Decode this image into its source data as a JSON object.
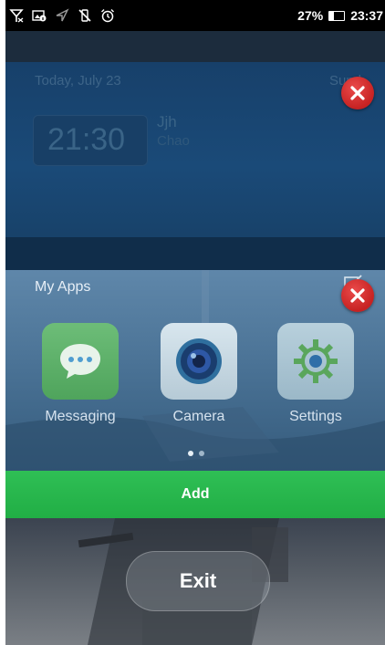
{
  "status_bar": {
    "battery_percent": "27%",
    "time": "23:37",
    "icons": [
      "signal-off-icon",
      "image-info-icon",
      "location-icon",
      "vibrate-off-icon",
      "alarm-icon",
      "battery-icon"
    ]
  },
  "recent_cards": [
    {
      "widget": {
        "date": "Today, July 23",
        "day": "Sund",
        "clock": "21:30",
        "event_title": "Jjh",
        "event_subtitle": "Chao"
      },
      "close_icon": "close-icon"
    },
    {
      "title": "My Apps",
      "apps": [
        {
          "label": "Messaging",
          "icon": "messaging-icon"
        },
        {
          "label": "Camera",
          "icon": "camera-icon"
        },
        {
          "label": "Settings",
          "icon": "settings-icon"
        }
      ],
      "page_count": 2,
      "active_page": 1,
      "close_icon": "close-icon"
    }
  ],
  "actions": {
    "add_label": "Add",
    "exit_label": "Exit"
  },
  "colors": {
    "add_bar": "#21ae45",
    "close_button": "#c62222"
  }
}
